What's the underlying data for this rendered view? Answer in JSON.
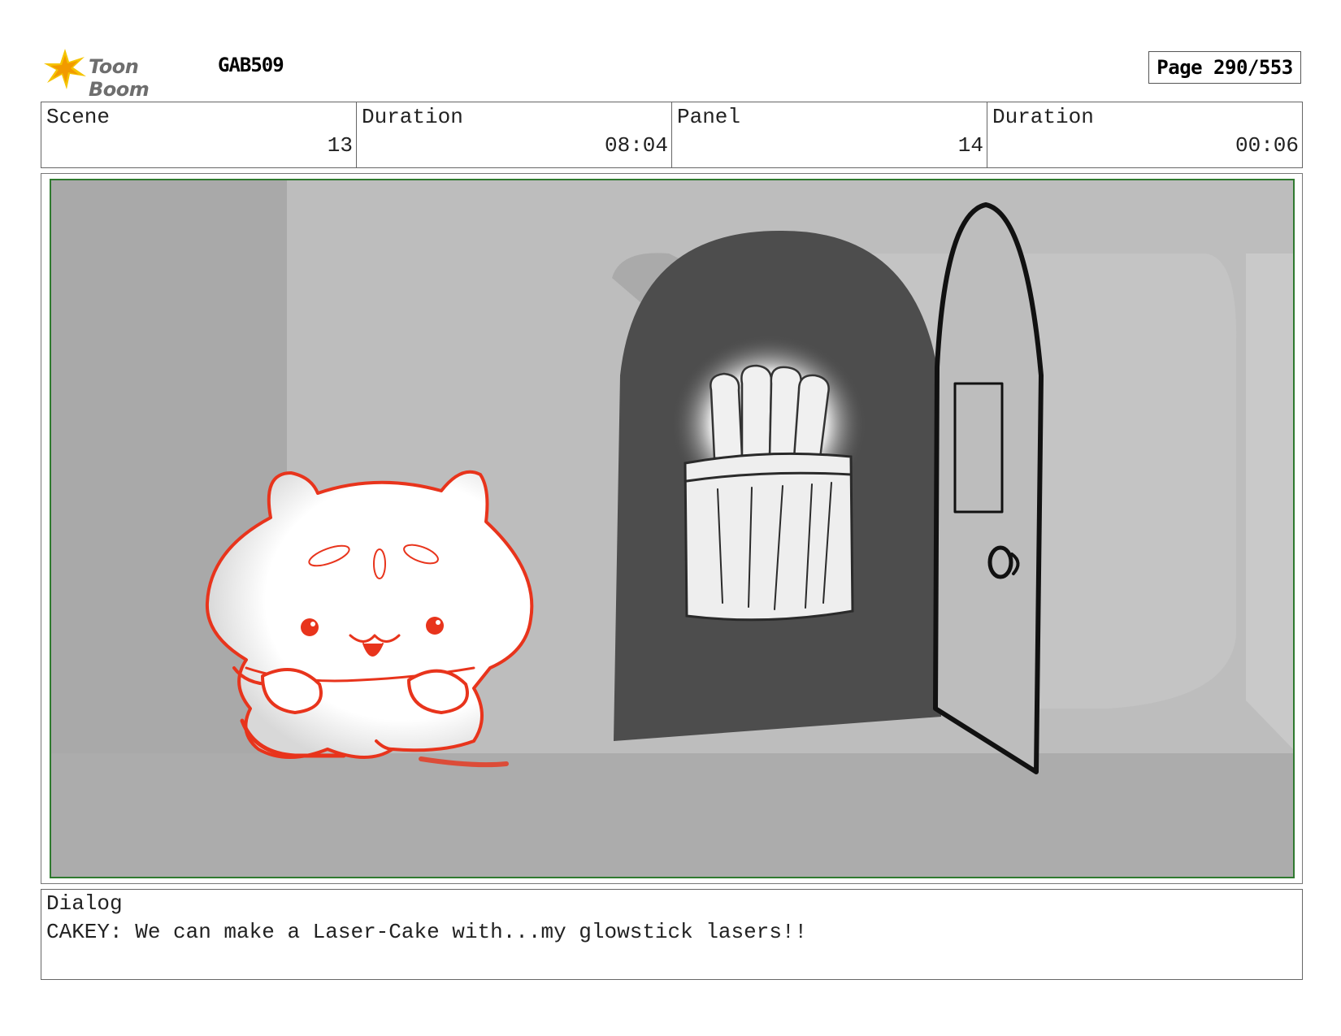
{
  "header": {
    "logo_text": "Toon Boom",
    "project": "GAB509",
    "page_label": "Page 290/553"
  },
  "info": {
    "scene_label": "Scene",
    "scene_value": "13",
    "scene_duration_label": "Duration",
    "scene_duration_value": "08:04",
    "panel_label": "Panel",
    "panel_value": "14",
    "panel_duration_label": "Duration",
    "panel_duration_value": "00:06"
  },
  "dialog": {
    "label": "Dialog",
    "text": "CAKEY: We can make a Laser-Cake with...my glowstick lasers!!"
  },
  "colors": {
    "panel_border": "#2f7a2f",
    "character_line": "#e8341c",
    "door_dark": "#4d4d4d",
    "background_gray": "#b4b4b4"
  }
}
